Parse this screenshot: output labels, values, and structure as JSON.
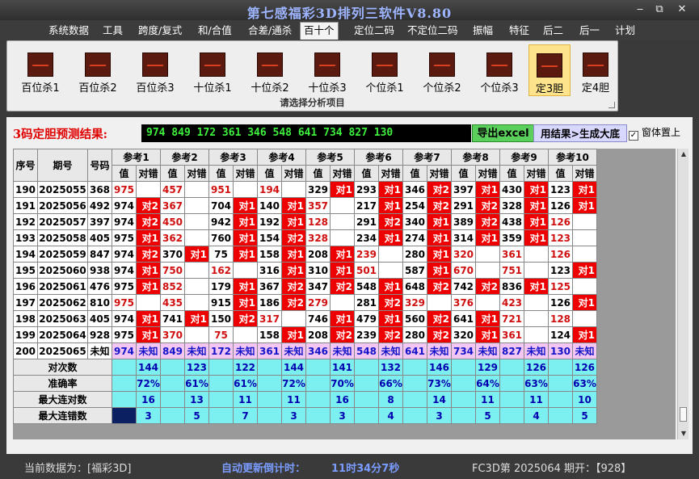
{
  "window": {
    "title": "第七感福彩3D排列三软件V8.80",
    "min": "‒",
    "max": "⧉",
    "close": "✕"
  },
  "menu": [
    "系统数据",
    "工具",
    "跨度/复式",
    "和/合值",
    "合差/通杀",
    "百十个",
    "定位二码",
    "不定位二码",
    "振幅",
    "特征",
    "后二",
    "后一",
    "计划"
  ],
  "active_menu": "百十个",
  "ribbon": {
    "buttons": [
      "百位杀1",
      "百位杀2",
      "百位杀3",
      "十位杀1",
      "十位杀2",
      "十位杀3",
      "个位杀1",
      "个位杀2",
      "个位杀3",
      "定3胆",
      "定4胆"
    ],
    "selected": "定3胆",
    "group_label": "请选择分析项目"
  },
  "prediction": {
    "label": "3码定胆预测结果:",
    "value": "974 849 172 361 346 548 641 734 827 130",
    "export_btn": "导出excel",
    "calc_btn": "用结果>生成大底",
    "topmost_label": "窗体置上",
    "topmost_checked": true
  },
  "table": {
    "headers": {
      "seq": "序号",
      "issue": "期号",
      "num": "号码",
      "val": "值",
      "res": "对错",
      "refs": [
        "参考1",
        "参考2",
        "参考3",
        "参考4",
        "参考5",
        "参考6",
        "参考7",
        "参考8",
        "参考9",
        "参考10"
      ]
    },
    "rows": [
      {
        "seq": "190",
        "issue": "2025055",
        "num": "368",
        "cells": [
          [
            "975",
            ""
          ],
          [
            "457",
            ""
          ],
          [
            "951",
            ""
          ],
          [
            "194",
            ""
          ],
          [
            "329",
            "对1"
          ],
          [
            "293",
            "对1"
          ],
          [
            "346",
            "对2"
          ],
          [
            "397",
            "对1"
          ],
          [
            "430",
            "对1"
          ],
          [
            "123",
            "对1"
          ]
        ]
      },
      {
        "seq": "191",
        "issue": "2025056",
        "num": "492",
        "cells": [
          [
            "974",
            "对2"
          ],
          [
            "367",
            ""
          ],
          [
            "704",
            "对1"
          ],
          [
            "140",
            "对1"
          ],
          [
            "357",
            ""
          ],
          [
            "217",
            "对1"
          ],
          [
            "254",
            "对2"
          ],
          [
            "291",
            "对2"
          ],
          [
            "328",
            "对1"
          ],
          [
            "126",
            "对1"
          ]
        ]
      },
      {
        "seq": "192",
        "issue": "2025057",
        "num": "397",
        "cells": [
          [
            "974",
            "对2"
          ],
          [
            "450",
            ""
          ],
          [
            "942",
            "对1"
          ],
          [
            "192",
            "对1"
          ],
          [
            "128",
            ""
          ],
          [
            "291",
            "对2"
          ],
          [
            "340",
            "对1"
          ],
          [
            "389",
            "对2"
          ],
          [
            "438",
            "对1"
          ],
          [
            "126",
            ""
          ]
        ]
      },
      {
        "seq": "193",
        "issue": "2025058",
        "num": "405",
        "cells": [
          [
            "975",
            "对1"
          ],
          [
            "362",
            ""
          ],
          [
            "760",
            "对1"
          ],
          [
            "154",
            "对2"
          ],
          [
            "328",
            ""
          ],
          [
            "234",
            "对1"
          ],
          [
            "274",
            "对1"
          ],
          [
            "314",
            "对1"
          ],
          [
            "359",
            "对1"
          ],
          [
            "123",
            ""
          ]
        ]
      },
      {
        "seq": "194",
        "issue": "2025059",
        "num": "847",
        "cells": [
          [
            "974",
            "对2"
          ],
          [
            "370",
            "对1"
          ],
          [
            "75",
            "对1"
          ],
          [
            "158",
            "对1"
          ],
          [
            "208",
            "对1"
          ],
          [
            "239",
            ""
          ],
          [
            "280",
            "对1"
          ],
          [
            "320",
            ""
          ],
          [
            "361",
            ""
          ],
          [
            "126",
            ""
          ]
        ]
      },
      {
        "seq": "195",
        "issue": "2025060",
        "num": "938",
        "cells": [
          [
            "974",
            "对1"
          ],
          [
            "750",
            ""
          ],
          [
            "162",
            ""
          ],
          [
            "316",
            "对1"
          ],
          [
            "310",
            "对1"
          ],
          [
            "501",
            ""
          ],
          [
            "587",
            "对1"
          ],
          [
            "670",
            ""
          ],
          [
            "751",
            ""
          ],
          [
            "123",
            "对1"
          ]
        ]
      },
      {
        "seq": "196",
        "issue": "2025061",
        "num": "476",
        "cells": [
          [
            "975",
            "对1"
          ],
          [
            "852",
            ""
          ],
          [
            "179",
            "对1"
          ],
          [
            "367",
            "对2"
          ],
          [
            "347",
            "对2"
          ],
          [
            "548",
            "对1"
          ],
          [
            "648",
            "对2"
          ],
          [
            "742",
            "对2"
          ],
          [
            "836",
            "对1"
          ],
          [
            "125",
            ""
          ]
        ]
      },
      {
        "seq": "197",
        "issue": "2025062",
        "num": "810",
        "cells": [
          [
            "975",
            ""
          ],
          [
            "435",
            ""
          ],
          [
            "915",
            "对1"
          ],
          [
            "186",
            "对2"
          ],
          [
            "279",
            ""
          ],
          [
            "281",
            "对2"
          ],
          [
            "329",
            ""
          ],
          [
            "376",
            ""
          ],
          [
            "423",
            ""
          ],
          [
            "126",
            "对1"
          ]
        ]
      },
      {
        "seq": "198",
        "issue": "2025063",
        "num": "405",
        "cells": [
          [
            "974",
            "对1"
          ],
          [
            "741",
            "对1"
          ],
          [
            "150",
            "对2"
          ],
          [
            "317",
            ""
          ],
          [
            "746",
            "对1"
          ],
          [
            "479",
            "对1"
          ],
          [
            "560",
            "对2"
          ],
          [
            "641",
            "对1"
          ],
          [
            "721",
            ""
          ],
          [
            "128",
            ""
          ]
        ]
      },
      {
        "seq": "199",
        "issue": "2025064",
        "num": "928",
        "cells": [
          [
            "975",
            "对1"
          ],
          [
            "370",
            ""
          ],
          [
            "75",
            ""
          ],
          [
            "158",
            "对1"
          ],
          [
            "208",
            "对2"
          ],
          [
            "239",
            "对2"
          ],
          [
            "280",
            "对2"
          ],
          [
            "320",
            "对1"
          ],
          [
            "361",
            ""
          ],
          [
            "124",
            "对1"
          ]
        ]
      }
    ],
    "last_row": {
      "seq": "200",
      "issue": "2025065",
      "num": "未知",
      "cells": [
        "974",
        "849",
        "172",
        "361",
        "346",
        "548",
        "641",
        "734",
        "827",
        "130"
      ],
      "unknown": "未知"
    },
    "stats": [
      {
        "label": "对次数",
        "values": [
          "144",
          "123",
          "122",
          "144",
          "141",
          "132",
          "146",
          "129",
          "126",
          "126"
        ]
      },
      {
        "label": "准确率",
        "values": [
          "72%",
          "61%",
          "61%",
          "72%",
          "70%",
          "66%",
          "73%",
          "64%",
          "63%",
          "63%"
        ]
      },
      {
        "label": "最大连对数",
        "values": [
          "16",
          "13",
          "11",
          "11",
          "16",
          "8",
          "14",
          "11",
          "11",
          "10"
        ]
      },
      {
        "label": "最大连错数",
        "values": [
          "3",
          "5",
          "7",
          "3",
          "3",
          "4",
          "3",
          "5",
          "4",
          "5"
        ]
      }
    ]
  },
  "status": {
    "current": "当前数据为：[福彩3D]",
    "countdown_label": "自动更新倒计时：",
    "countdown": "11时34分7秒",
    "latest": "FC3D第 2025064 期开：【928】"
  },
  "colors": {
    "hit": "#ee0000",
    "stat_bg": "#7cf0f0",
    "pred_text": "#3cf03c",
    "last_row_bg": "#f3c6f3"
  }
}
